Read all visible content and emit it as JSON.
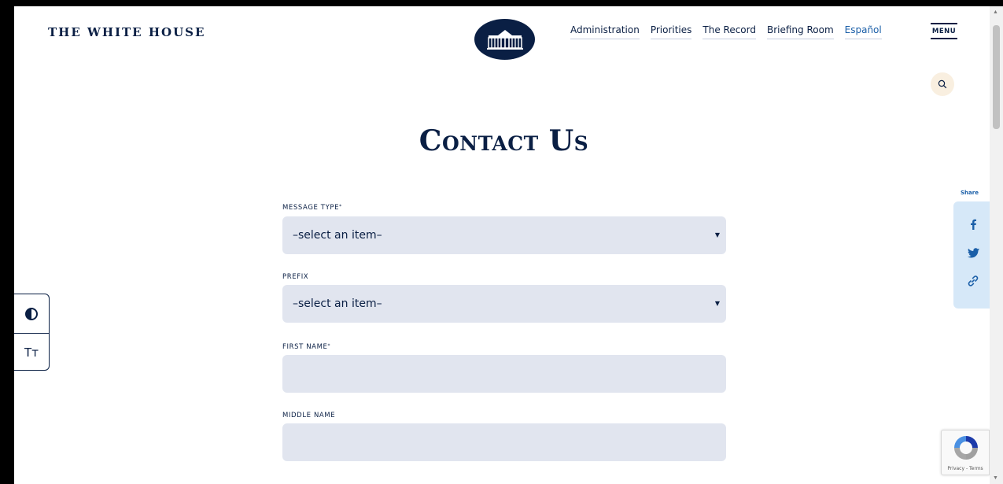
{
  "header": {
    "site_title": "THE WHITE HOUSE",
    "nav": [
      {
        "label": "Administration"
      },
      {
        "label": "Priorities"
      },
      {
        "label": "The Record"
      },
      {
        "label": "Briefing Room"
      },
      {
        "label": "Español"
      }
    ],
    "menu_label": "MENU"
  },
  "page": {
    "title": "Contact Us"
  },
  "form": {
    "message_type": {
      "label": "MESSAGE TYPE",
      "required_mark": "*",
      "value": "–select an item–"
    },
    "prefix": {
      "label": "PREFIX",
      "value": "–select an item–"
    },
    "first_name": {
      "label": "FIRST NAME",
      "required_mark": "*",
      "value": ""
    },
    "middle_name": {
      "label": "MIDDLE NAME",
      "value": ""
    }
  },
  "a11y": {
    "contrast_icon": "contrast-icon",
    "text_size_label": "Tт"
  },
  "share": {
    "label": "Share",
    "icons": [
      "facebook-icon",
      "twitter-icon",
      "link-icon"
    ]
  },
  "recaptcha": {
    "text": "Privacy - Terms"
  },
  "colors": {
    "navy": "#0a1f44",
    "field_bg": "#e1e5ef",
    "share_bg": "#d6e8f8",
    "accent_blue": "#1b5fa8"
  }
}
